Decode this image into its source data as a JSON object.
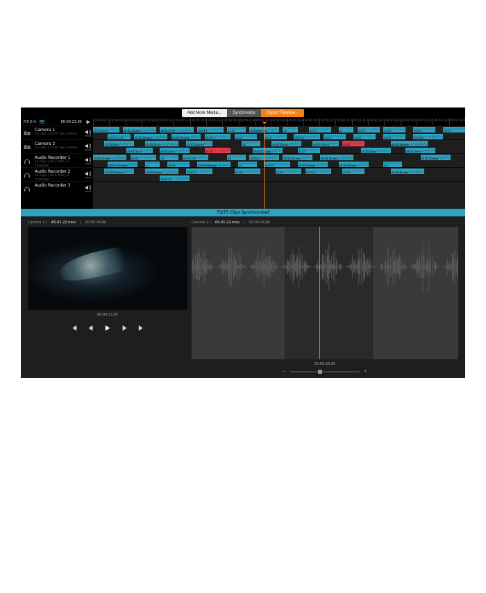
{
  "toolbar": {
    "add": "Add More Media...",
    "sync": "Synchronize",
    "export": "Export Timeline..."
  },
  "media": {
    "label": "MEDIA",
    "timecode": "00:00:23,05"
  },
  "tracks": [
    {
      "name": "Camera 1",
      "meta": "23 clips | 23.97 fps | stereo",
      "icon": "camera"
    },
    {
      "name": "Camera 2",
      "meta": "13 clips | 23.97 fps | stereo",
      "icon": "camera"
    },
    {
      "name": "Audio Recorder 1",
      "meta": "14 clips | 44.1 KHz | 2 channels",
      "icon": "headphones"
    },
    {
      "name": "Audio Recorder 2",
      "meta": "12 clips | 44.1 KHz | 2 channels",
      "icon": "headphones"
    },
    {
      "name": "Audio Recorder 3",
      "meta": "",
      "icon": "headphones"
    }
  ],
  "ruler": [
    "00:00:02,00",
    "00:00:04,00",
    "00:00:06,00",
    "00:00:08,00",
    "00:00:10,00",
    "00:00:12,00",
    "00:00:14,00",
    "00:00:16,00",
    "00:00:18,00",
    "00:00:20,00",
    "00:00:22,00",
    "00:00:24,00",
    "00:00:26,00",
    "00:00:28,00",
    "00:00:30,00",
    "00:00:32,00",
    "00:00:34,00",
    "00:00:36,00",
    "00:00:38,00",
    "00:00:40,00",
    "00:00:42,00",
    "00:00:44,00",
    "00:00:46,00"
  ],
  "sync_status": "75/75  Clips Synchronized",
  "preview": {
    "track": "Camera 1 /",
    "file": "A5-01-22.mov",
    "dur": "00:00:04,80",
    "tc": "00:00:23,05"
  },
  "wave": {
    "track": "Camera 1 /",
    "file": "A5-01-22.mov",
    "dur": "00:00:04,80",
    "tc": "00:00:23,05",
    "zoom_minus": "−",
    "zoom_plus": "+"
  },
  "lanes": [
    {
      "rows": [
        [
          {
            "l": 0,
            "w": 7,
            "n": "A5-01-12.m"
          },
          {
            "l": 8,
            "w": 9,
            "n": "A5-01-14.mov"
          },
          {
            "l": 18,
            "w": 9,
            "n": "A5-01-17.m"
          },
          {
            "l": 28,
            "w": 7,
            "n": "A5-01-1"
          },
          {
            "l": 36,
            "w": 5,
            "n": "A5-01"
          },
          {
            "l": 42,
            "w": 8,
            "n": "A5-01-22.mov"
          },
          {
            "l": 51,
            "w": 4,
            "n": "A5"
          },
          {
            "l": 58,
            "w": 6,
            "n": "A5-01"
          },
          {
            "l": 66,
            "w": 4,
            "n": "A5"
          },
          {
            "l": 71,
            "w": 6,
            "n": "A5-01"
          },
          {
            "l": 78,
            "w": 6,
            "n": "A5-01"
          },
          {
            "l": 86,
            "w": 6,
            "n": "A5-01"
          },
          {
            "l": 94,
            "w": 6,
            "n": "A5-01"
          }
        ],
        [
          {
            "l": 4,
            "w": 6,
            "n": "A5-01-13.m"
          },
          {
            "l": 11,
            "w": 9,
            "n": "A5-01-15.mov"
          },
          {
            "l": 21,
            "w": 8,
            "n": "A5-01-18.mov"
          },
          {
            "l": 30,
            "w": 7,
            "n": "A5-01-2"
          },
          {
            "l": 38,
            "w": 6,
            "n": "A5-01"
          },
          {
            "l": 46,
            "w": 6,
            "n": "A5-01"
          },
          {
            "l": 54,
            "w": 7,
            "n": "A5-01-2"
          },
          {
            "l": 62,
            "w": 6,
            "n": "A5-01"
          },
          {
            "l": 70,
            "w": 6,
            "n": "A5-01"
          },
          {
            "l": 78,
            "w": 6,
            "n": "A5-01"
          },
          {
            "l": 86,
            "w": 8,
            "n": "A5-01-3"
          }
        ]
      ]
    },
    {
      "rows": [
        [
          {
            "l": 3,
            "w": 8,
            "n": "A5-01-14.m"
          },
          {
            "l": 14,
            "w": 9,
            "n": "A5-01-17.m"
          },
          {
            "l": 25,
            "w": 7,
            "n": "A5-01-18.mov"
          },
          {
            "l": 40,
            "w": 5,
            "n": "A5"
          },
          {
            "l": 48,
            "w": 8,
            "n": "A5-01-23a.m"
          },
          {
            "l": 59,
            "w": 7,
            "n": "A5-01-23b.m"
          },
          {
            "l": 67,
            "w": 6,
            "n": "A5-02",
            "red": true
          },
          {
            "l": 80,
            "w": 10,
            "n": "A5-02-26.mov"
          }
        ],
        [
          {
            "l": 9,
            "w": 7,
            "n": "A5-01-16.m"
          },
          {
            "l": 18,
            "w": 8,
            "n": "A5-01-25.m"
          },
          {
            "l": 30,
            "w": 7,
            "n": "A5-01",
            "red": true
          },
          {
            "l": 43,
            "w": 8,
            "n": "A5-01-22.mov"
          },
          {
            "l": 55,
            "w": 6,
            "n": "A5-01"
          },
          {
            "l": 72,
            "w": 8,
            "n": "A5-01-24.m"
          },
          {
            "l": 84,
            "w": 8,
            "n": "A5-01-29.m"
          }
        ]
      ]
    },
    {
      "rows": [
        [
          {
            "l": 0,
            "w": 9,
            "n": "A5-01-12.wav"
          },
          {
            "l": 10,
            "w": 7,
            "n": "A5-01"
          },
          {
            "l": 18,
            "w": 5,
            "n": "A5"
          },
          {
            "l": 24,
            "w": 7,
            "n": "A5-01-17b"
          },
          {
            "l": 36,
            "w": 5,
            "n": "A5"
          },
          {
            "l": 42,
            "w": 8,
            "n": "A5-01-1"
          },
          {
            "l": 51,
            "w": 8,
            "n": "A5-01-21.wav"
          },
          {
            "l": 61,
            "w": 9,
            "n": "A5-01-23.wav"
          },
          {
            "l": 88,
            "w": 8,
            "n": "A5-01-30.wav"
          }
        ],
        [
          {
            "l": 4,
            "w": 8,
            "n": "A5-01-13b.wav"
          },
          {
            "l": 14,
            "w": 4,
            "n": "A1"
          },
          {
            "l": 20,
            "w": 6,
            "n": "A5-01"
          },
          {
            "l": 28,
            "w": 9,
            "n": "A5-01-18b.wav"
          },
          {
            "l": 39,
            "w": 5,
            "n": "A5"
          },
          {
            "l": 46,
            "w": 7,
            "n": "A5-01-1"
          },
          {
            "l": 55,
            "w": 8,
            "n": "A5-01-22.wav"
          },
          {
            "l": 66,
            "w": 8,
            "n": "A5-01-25.wav"
          },
          {
            "l": 78,
            "w": 5,
            "n": "A5"
          }
        ]
      ]
    },
    {
      "rows": [
        [
          {
            "l": 3,
            "w": 8,
            "n": "A5-01-13b.wav"
          },
          {
            "l": 14,
            "w": 9,
            "n": "A5-01-14.wav"
          },
          {
            "l": 25,
            "w": 7,
            "n": "A5-01-1"
          },
          {
            "l": 38,
            "w": 7,
            "n": "A5-01"
          },
          {
            "l": 49,
            "w": 7,
            "n": "A5-01"
          },
          {
            "l": 57,
            "w": 7,
            "n": "A5-01-2"
          },
          {
            "l": 67,
            "w": 6,
            "n": "A5-01"
          },
          {
            "l": 80,
            "w": 9,
            "n": "A5-01-41.wav"
          }
        ],
        [
          {
            "l": 18,
            "w": 8,
            "n": "A5-01-15"
          }
        ]
      ]
    },
    {
      "rows": [
        [],
        []
      ]
    }
  ]
}
